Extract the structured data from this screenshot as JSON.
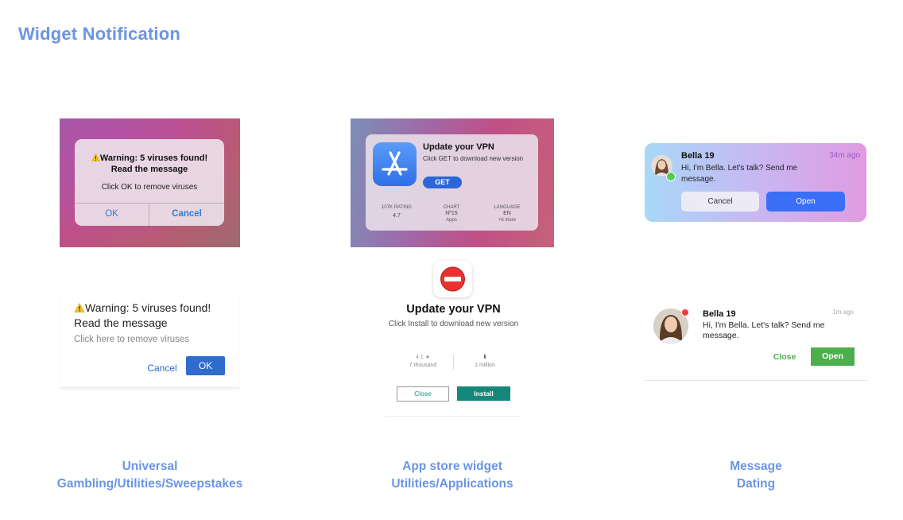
{
  "page": {
    "title": "Widget Notification"
  },
  "col1": {
    "ios": {
      "warning_icon": "warning-icon",
      "title": "Warning: 5 viruses found!",
      "subtitle": "Read the message",
      "message": "Click OK to remove viruses",
      "ok_label": "OK",
      "cancel_label": "Cancel"
    },
    "android": {
      "title": "Warning: 5 viruses found!",
      "subtitle": "Read the message",
      "message": "Click here to remove viruses",
      "cancel_label": "Cancel",
      "ok_label": "OK"
    },
    "caption_line1": "Universal",
    "caption_line2": "Gambling/Utilities/Sweepstakes"
  },
  "col2": {
    "ios": {
      "title": "Update your VPN",
      "subtitle": "Click GET to download new version",
      "get_label": "GET",
      "stats": [
        {
          "label": "107K RATING",
          "value": "4.7",
          "sub": ""
        },
        {
          "label": "CHART",
          "value": "Nº15",
          "sub": "Apps"
        },
        {
          "label": "LANGUAGE",
          "value": "EN",
          "sub": "+6 more"
        }
      ]
    },
    "android": {
      "title": "Update your VPN",
      "subtitle": "Click Install to download new version",
      "rating": "4.1 ★",
      "rating_sub": "7 thousand",
      "downloads": "⬇",
      "downloads_sub": "1 million",
      "close_label": "Close",
      "install_label": "Install"
    },
    "caption_line1": "App store widget",
    "caption_line2": "Utilities/Applications"
  },
  "col3": {
    "ios": {
      "name": "Bella 19",
      "time": "34m ago",
      "message": "Hi, I'm Bella. Let's talk? Send me message.",
      "cancel_label": "Cancel",
      "open_label": "Open"
    },
    "android": {
      "name": "Bella 19",
      "time": "1m ago",
      "message": "Hi, I'm Bella. Let's talk? Send me message.",
      "close_label": "Close",
      "open_label": "Open"
    },
    "caption_line1": "Message",
    "caption_line2": "Dating"
  }
}
